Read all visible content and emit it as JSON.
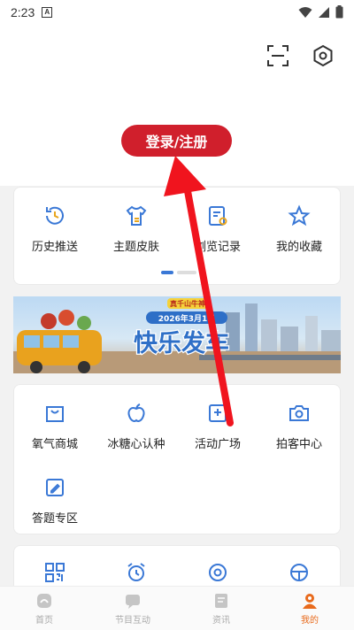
{
  "status_bar": {
    "time": "2:23",
    "app_icon_letter": "A"
  },
  "header": {
    "scan_icon": "scan-icon",
    "settings_icon": "settings-icon"
  },
  "login": {
    "label": "登录/注册"
  },
  "quick_menu": {
    "items": [
      {
        "label": "历史推送",
        "icon": "history-icon"
      },
      {
        "label": "主题皮肤",
        "icon": "skin-icon"
      },
      {
        "label": "浏览记录",
        "icon": "browse-record-icon"
      },
      {
        "label": "我的收藏",
        "icon": "star-icon"
      }
    ],
    "page_indicator": {
      "current": 1,
      "total": 2
    }
  },
  "banner": {
    "badge": "真千山牛神",
    "date_line": "2026年3月1日",
    "headline": "快乐发车"
  },
  "services": {
    "items": [
      {
        "label": "氧气商城",
        "icon": "mall-icon"
      },
      {
        "label": "冰糖心认种",
        "icon": "apple-icon"
      },
      {
        "label": "活动广场",
        "icon": "activity-icon"
      },
      {
        "label": "拍客中心",
        "icon": "camera-icon"
      },
      {
        "label": "答题专区",
        "icon": "quiz-icon"
      }
    ]
  },
  "more_tools": {
    "icons": [
      "qrcode-icon",
      "alarm-icon",
      "refresh-target-icon",
      "steering-wheel-icon"
    ]
  },
  "tab_bar": {
    "tabs": [
      {
        "label": "首页",
        "icon": "home-icon",
        "active": false
      },
      {
        "label": "节目互动",
        "icon": "interact-icon",
        "active": false
      },
      {
        "label": "资讯",
        "icon": "news-icon",
        "active": false
      },
      {
        "label": "我的",
        "icon": "profile-icon",
        "active": true
      }
    ],
    "active_color": "#e86a1c"
  },
  "colors": {
    "accent_red": "#d01f2c",
    "icon_blue": "#3a78d6"
  }
}
